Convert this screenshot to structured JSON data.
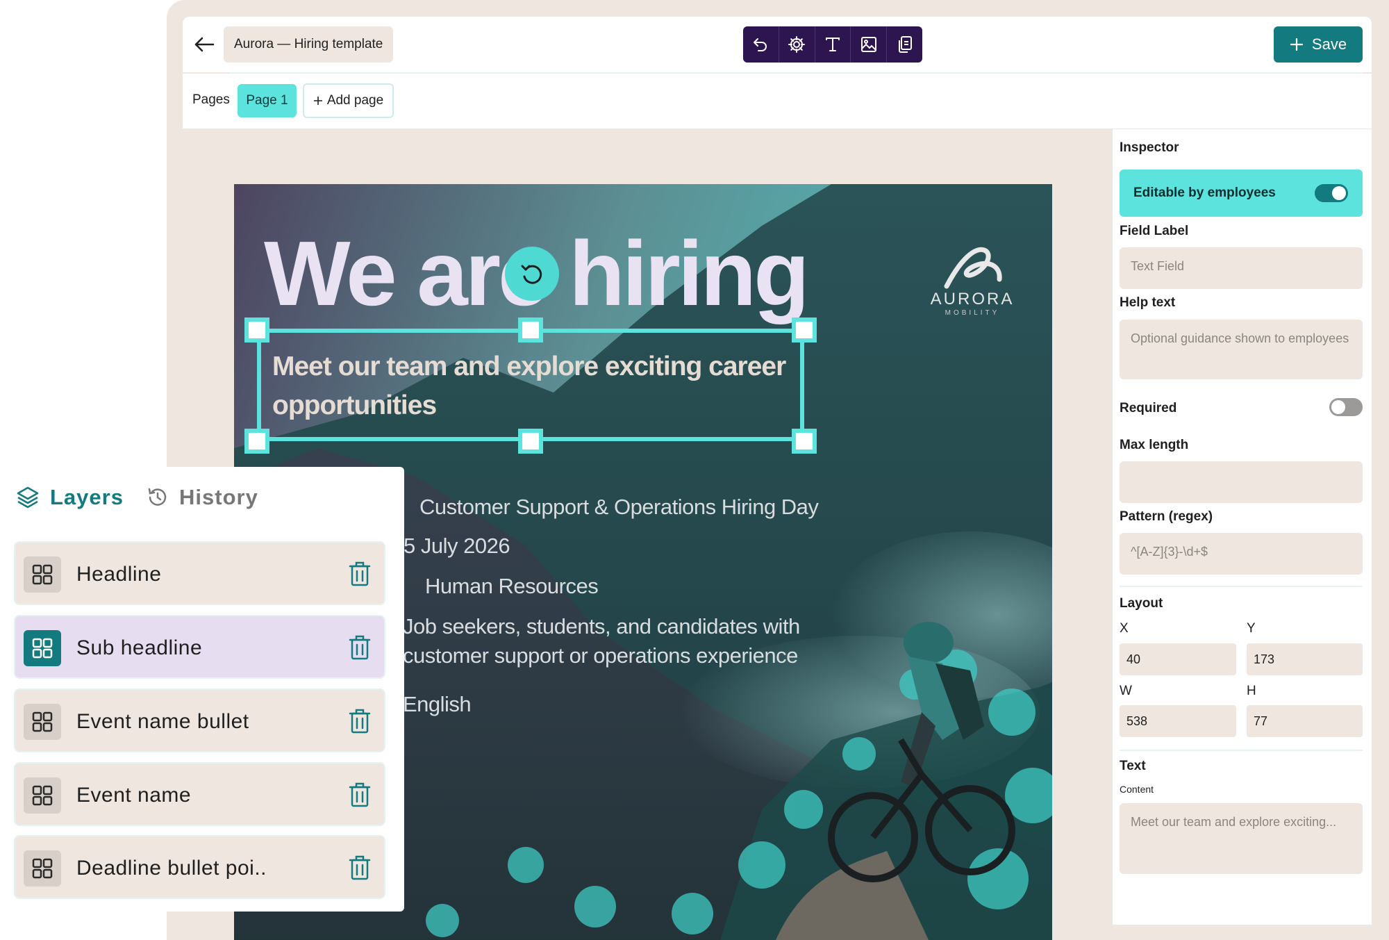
{
  "header": {
    "back_icon": "arrow-left-icon",
    "document_title": "Aurora — Hiring template",
    "toolbar_icons": [
      "undo-icon",
      "settings-icon",
      "text-icon",
      "image-icon",
      "duplicate-icon"
    ],
    "save_label": "Save"
  },
  "pages": {
    "label": "Pages",
    "tabs": [
      {
        "label": "Page 1",
        "active": true
      }
    ],
    "add_label": "Add page"
  },
  "poster": {
    "headline": "We are hiring",
    "subheadline": "Meet our team and explore exciting career opportunities",
    "event_name": "Customer Support & Operations Hiring Day",
    "date": "5 July 2026",
    "department": "Human Resources",
    "audience_line1": "Job seekers, students, and candidates with",
    "audience_line2": "customer support or operations experience",
    "language": "English",
    "logo_word": "AURORA",
    "logo_sub": "MOBILITY"
  },
  "inspector": {
    "title": "Inspector",
    "editable_label": "Editable by employees",
    "editable_on": true,
    "field_label_title": "Field Label",
    "field_label_placeholder": "Text Field",
    "help_text_title": "Help text",
    "help_text_placeholder": "Optional guidance shown to employees",
    "required_label": "Required",
    "required_on": false,
    "max_length_label": "Max length",
    "max_length_value": "",
    "pattern_label": "Pattern (regex)",
    "pattern_placeholder": "^[A-Z]{3}-\\d+$",
    "layout_title": "Layout",
    "x_label": "X",
    "x_value": "40",
    "y_label": "Y",
    "y_value": "173",
    "w_label": "W",
    "w_value": "538",
    "h_label": "H",
    "h_value": "77",
    "text_title": "Text",
    "content_label": "Content",
    "content_value": "Meet our team and explore exciting..."
  },
  "layers_panel": {
    "tab_layers": "Layers",
    "tab_history": "History",
    "active_tab": "Layers",
    "items": [
      {
        "label": "Headline",
        "active": false
      },
      {
        "label": "Sub headline",
        "active": true
      },
      {
        "label": "Event name bullet",
        "active": false
      },
      {
        "label": "Event name",
        "active": false
      },
      {
        "label": "Deadline bullet poi..",
        "active": false
      }
    ]
  },
  "colors": {
    "accent": "#137a80",
    "highlight": "#5ce3dd",
    "toolbar": "#2d1650",
    "panel_bg": "#efe7df",
    "active_layer": "#e6def0"
  }
}
